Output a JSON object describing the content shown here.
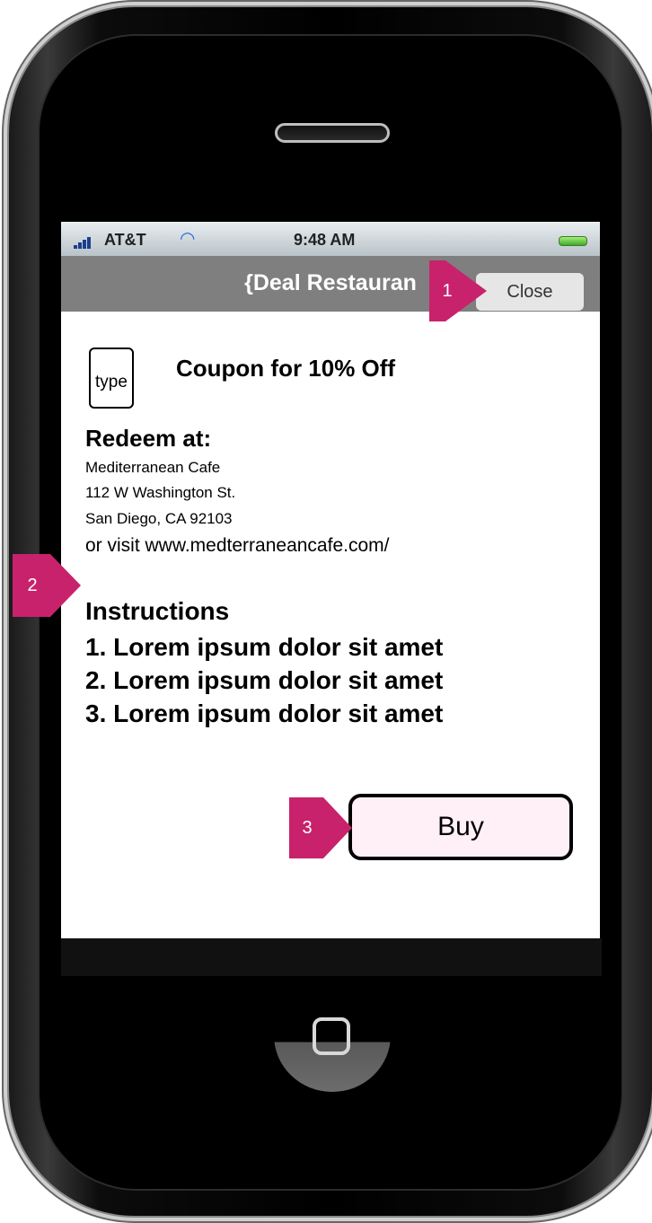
{
  "status_bar": {
    "carrier": "AT&T",
    "time": "9:48 AM"
  },
  "nav": {
    "title": "{Deal Restauran",
    "close_label": "Close"
  },
  "coupon": {
    "type_label": "type",
    "title": "Coupon for 10% Off"
  },
  "redeem": {
    "heading": "Redeem at:",
    "lines": [
      "Mediterranean Cafe",
      "112 W Washington St.",
      "San Diego, CA 92103",
      "or visit www.medterraneancafe.com/"
    ]
  },
  "instructions": {
    "heading": "Instructions",
    "items": [
      "1. Lorem ipsum dolor sit amet",
      "2. Lorem ipsum dolor sit amet",
      "3. Lorem ipsum dolor sit amet"
    ]
  },
  "buy_label": "Buy",
  "annotations": [
    "1",
    "2",
    "3"
  ],
  "colors": {
    "annotation": "#c8226c",
    "nav_bar": "#7f7f7f",
    "buy_button_bg": "#fff0f8"
  }
}
